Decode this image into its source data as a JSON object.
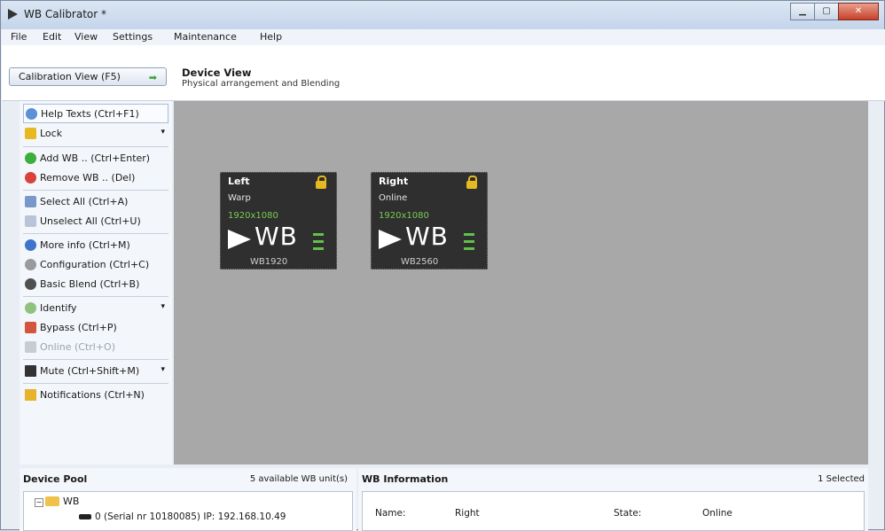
{
  "window": {
    "title": "WB Calibrator *"
  },
  "menu": [
    "File",
    "Edit",
    "View",
    "Settings",
    "Maintenance",
    "Help"
  ],
  "header": {
    "calibration_button": "Calibration View (F5)",
    "view_title": "Device View",
    "view_subtitle": "Physical arrangement and Blending"
  },
  "toolbar": {
    "help": "Help Texts (Ctrl+F1)",
    "lock": "Lock",
    "add": "Add WB .. (Ctrl+Enter)",
    "remove": "Remove WB .. (Del)",
    "select_all": "Select All (Ctrl+A)",
    "unselect_all": "Unselect All (Ctrl+U)",
    "more_info": "More info (Ctrl+M)",
    "configuration": "Configuration (Ctrl+C)",
    "basic_blend": "Basic Blend (Ctrl+B)",
    "identify": "Identify",
    "bypass": "Bypass (Ctrl+P)",
    "online": "Online (Ctrl+O)",
    "mute": "Mute (Ctrl+Shift+M)",
    "notifications": "Notifications (Ctrl+N)"
  },
  "devices": [
    {
      "name": "Left",
      "status": "Warp",
      "resolution": "1920x1080",
      "brand": "WB",
      "model": "WB1920"
    },
    {
      "name": "Right",
      "status": "Online",
      "resolution": "1920x1080",
      "brand": "WB",
      "model": "WB2560"
    }
  ],
  "pool": {
    "title": "Device Pool",
    "available": "5 available WB unit(s)",
    "root": "WB",
    "entry": "0 (Serial nr 10180085) IP: 192.168.10.49"
  },
  "info": {
    "title": "WB Information",
    "selected": "1 Selected",
    "name_label": "Name:",
    "name_value": "Right",
    "state_label": "State:",
    "state_value": "Online"
  },
  "colors": {
    "canvas": "#a8a8a8",
    "tile": "#2f2f2f",
    "resolution": "#76cc52",
    "lock": "#e7b920"
  }
}
